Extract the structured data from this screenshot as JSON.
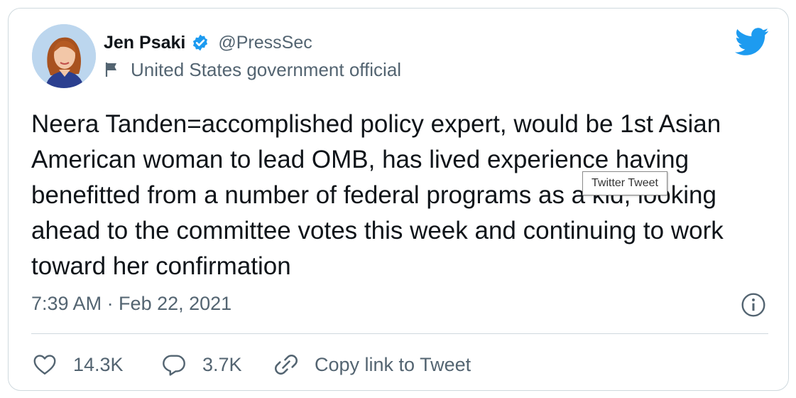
{
  "author": {
    "name": "Jen Psaki",
    "handle": "@PressSec",
    "affiliation": "United States government official",
    "verified": true
  },
  "tweet": {
    "text": "Neera Tanden=accomplished policy expert, would be 1st Asian American woman to lead OMB, has lived experience having benefitted from a number of federal programs as a kid, looking ahead to the committee votes this week and continuing to work toward her confirmation",
    "timestamp": "7:39 AM · Feb 22, 2021"
  },
  "tooltip": {
    "text": "Twitter Tweet"
  },
  "actions": {
    "likes": "14.3K",
    "replies": "3.7K",
    "copy_link": "Copy link to Tweet"
  },
  "colors": {
    "brand": "#1d9bf0",
    "secondary_text": "#536471",
    "border": "#cfd9de"
  },
  "icons": [
    "twitter-bird-icon",
    "verified-badge-icon",
    "flag-icon",
    "info-icon",
    "heart-icon",
    "reply-icon",
    "link-icon"
  ]
}
